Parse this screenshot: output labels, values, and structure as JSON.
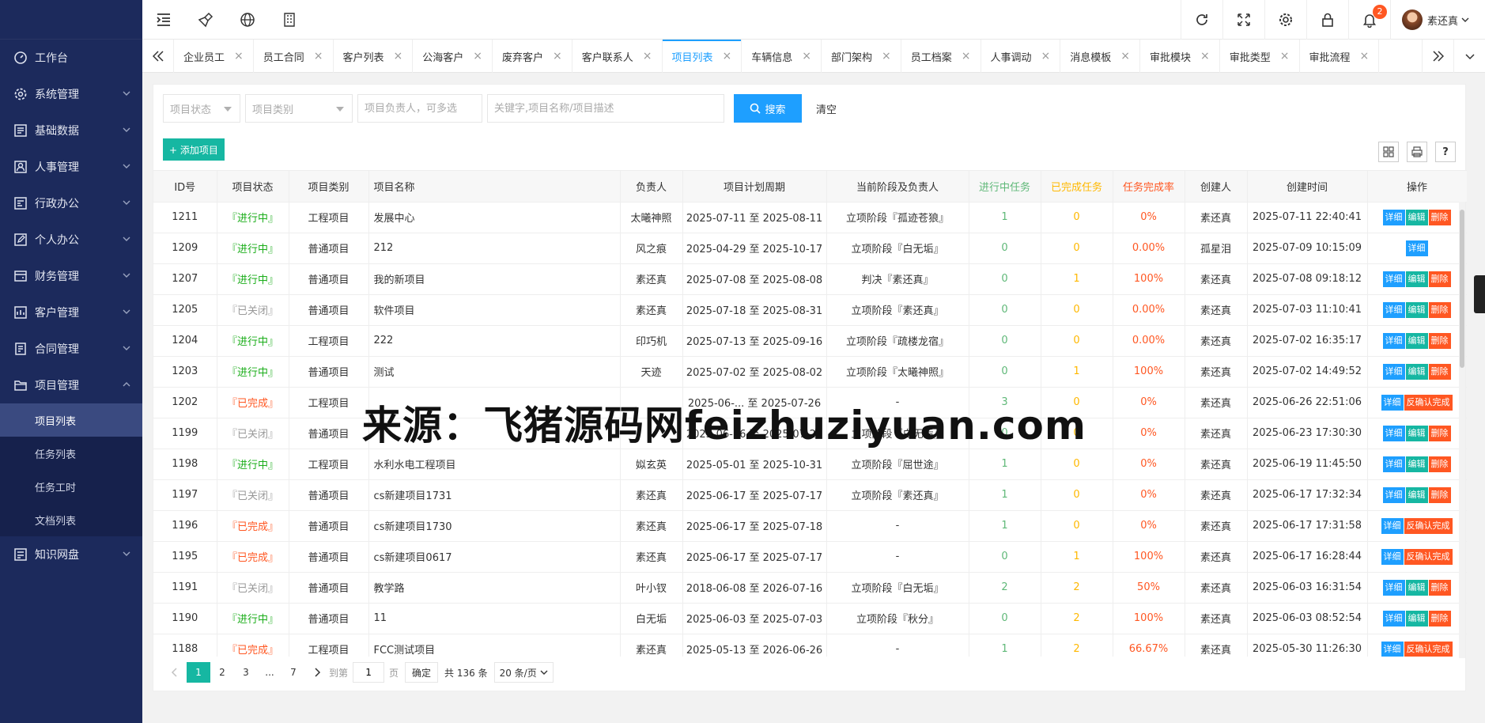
{
  "sidebar": {
    "items": [
      {
        "label": "工作台",
        "icon": "dashboard-icon"
      },
      {
        "label": "系统管理",
        "icon": "gear-icon"
      },
      {
        "label": "基础数据",
        "icon": "data-icon"
      },
      {
        "label": "人事管理",
        "icon": "person-icon"
      },
      {
        "label": "行政办公",
        "icon": "office-icon"
      },
      {
        "label": "个人办公",
        "icon": "edit-icon"
      },
      {
        "label": "财务管理",
        "icon": "finance-icon"
      },
      {
        "label": "客户管理",
        "icon": "customer-icon"
      },
      {
        "label": "合同管理",
        "icon": "contract-icon"
      },
      {
        "label": "项目管理",
        "icon": "folder-icon"
      },
      {
        "label": "知识网盘",
        "icon": "disk-icon"
      }
    ],
    "project_sub": [
      "项目列表",
      "任务列表",
      "任务工时",
      "文档列表"
    ]
  },
  "topbar": {
    "notification_count": "2",
    "user_name": "素还真"
  },
  "tabs": [
    "企业员工",
    "员工合同",
    "客户列表",
    "公海客户",
    "废弃客户",
    "客户联系人",
    "项目列表",
    "车辆信息",
    "部门架构",
    "员工档案",
    "人事调动",
    "消息模板",
    "审批模块",
    "审批类型",
    "审批流程"
  ],
  "filters": {
    "status_placeholder": "项目状态",
    "type_placeholder": "项目类别",
    "owner_placeholder": "项目负责人，可多选",
    "keyword_placeholder": "关键字,项目名称/项目描述",
    "search_label": "搜索",
    "clear_label": "清空"
  },
  "toolbar": {
    "add_label": "+ 添加项目"
  },
  "table": {
    "headers": [
      "ID号",
      "项目状态",
      "项目类别",
      "项目名称",
      "负责人",
      "项目计划周期",
      "当前阶段及负责人",
      "进行中任务",
      "已完成任务",
      "任务完成率",
      "创建人",
      "创建时间",
      "操作"
    ],
    "rows": [
      {
        "id": "1211",
        "status": "『进行中』",
        "st": "running",
        "type": "工程项目",
        "name": "发展中心",
        "owner": "太曦神照",
        "period": "2025-07-11 至 2025-08-11",
        "stage": "立项阶段『孤迹苍狼』",
        "doing": "1",
        "done": "0",
        "rate": "0%",
        "creator": "素还真",
        "created": "2025-07-11 22:40:41",
        "ops": "full"
      },
      {
        "id": "1209",
        "status": "『进行中』",
        "st": "running",
        "type": "普通项目",
        "name": "212",
        "owner": "风之痕",
        "period": "2025-04-29 至 2025-10-17",
        "stage": "立项阶段『白无垢』",
        "doing": "0",
        "done": "0",
        "rate": "0.00%",
        "creator": "孤星泪",
        "created": "2025-07-09 10:15:09",
        "ops": "detail"
      },
      {
        "id": "1207",
        "status": "『进行中』",
        "st": "running",
        "type": "普通项目",
        "name": "我的新项目",
        "owner": "素还真",
        "period": "2025-07-08 至 2025-08-08",
        "stage": "判决『素还真』",
        "doing": "0",
        "done": "1",
        "rate": "100%",
        "creator": "素还真",
        "created": "2025-07-08 09:18:12",
        "ops": "full"
      },
      {
        "id": "1205",
        "status": "『已关闭』",
        "st": "closed",
        "type": "普通项目",
        "name": "软件项目",
        "owner": "素还真",
        "period": "2025-07-18 至 2025-08-31",
        "stage": "立项阶段『素还真』",
        "doing": "0",
        "done": "0",
        "rate": "0.00%",
        "creator": "素还真",
        "created": "2025-07-03 11:10:41",
        "ops": "full"
      },
      {
        "id": "1204",
        "status": "『进行中』",
        "st": "running",
        "type": "工程项目",
        "name": "222",
        "owner": "印巧机",
        "period": "2025-07-13 至 2025-09-16",
        "stage": "立项阶段『疏楼龙宿』",
        "doing": "0",
        "done": "0",
        "rate": "0.00%",
        "creator": "素还真",
        "created": "2025-07-02 16:35:17",
        "ops": "full"
      },
      {
        "id": "1203",
        "status": "『进行中』",
        "st": "running",
        "type": "普通项目",
        "name": "测试",
        "owner": "天迹",
        "period": "2025-07-02 至 2025-08-02",
        "stage": "立项阶段『太曦神照』",
        "doing": "0",
        "done": "1",
        "rate": "100%",
        "creator": "素还真",
        "created": "2025-07-02 14:49:52",
        "ops": "full"
      },
      {
        "id": "1202",
        "status": "『已完成』",
        "st": "done",
        "type": "工程项目",
        "name": "",
        "owner": "",
        "period": "2025-06-... 至 2025-07-26",
        "stage": "-",
        "doing": "3",
        "done": "0",
        "rate": "0%",
        "creator": "素还真",
        "created": "2025-06-26 22:51:06",
        "ops": "reconfirm"
      },
      {
        "id": "1199",
        "status": "『已关闭』",
        "st": "closed",
        "type": "普通项目",
        "name": "",
        "owner": "",
        "period": "2025-06-16 至 2025-07-20",
        "stage": "立项阶段『白无垢』",
        "doing": "0",
        "done": "0",
        "rate": "0%",
        "creator": "素还真",
        "created": "2025-06-23 17:30:30",
        "ops": "full"
      },
      {
        "id": "1198",
        "status": "『进行中』",
        "st": "running",
        "type": "工程项目",
        "name": "水利水电工程项目",
        "owner": "姒玄英",
        "period": "2025-05-01 至 2025-10-31",
        "stage": "立项阶段『屈世途』",
        "doing": "1",
        "done": "0",
        "rate": "0%",
        "creator": "素还真",
        "created": "2025-06-19 11:45:50",
        "ops": "full"
      },
      {
        "id": "1197",
        "status": "『已关闭』",
        "st": "closed",
        "type": "普通项目",
        "name": "cs新建项目1731",
        "owner": "素还真",
        "period": "2025-06-17 至 2025-07-17",
        "stage": "立项阶段『素还真』",
        "doing": "1",
        "done": "0",
        "rate": "0%",
        "creator": "素还真",
        "created": "2025-06-17 17:32:34",
        "ops": "full"
      },
      {
        "id": "1196",
        "status": "『已完成』",
        "st": "done",
        "type": "普通项目",
        "name": "cs新建项目1730",
        "owner": "素还真",
        "period": "2025-06-17 至 2025-07-18",
        "stage": "-",
        "doing": "1",
        "done": "0",
        "rate": "0%",
        "creator": "素还真",
        "created": "2025-06-17 17:31:58",
        "ops": "reconfirm"
      },
      {
        "id": "1195",
        "status": "『已完成』",
        "st": "done",
        "type": "普通项目",
        "name": "cs新建项目0617",
        "owner": "素还真",
        "period": "2025-06-17 至 2025-07-17",
        "stage": "-",
        "doing": "0",
        "done": "1",
        "rate": "100%",
        "creator": "素还真",
        "created": "2025-06-17 16:28:44",
        "ops": "reconfirm"
      },
      {
        "id": "1191",
        "status": "『已关闭』",
        "st": "closed",
        "type": "普通项目",
        "name": "教学路",
        "owner": "叶小钗",
        "period": "2018-06-08 至 2026-07-16",
        "stage": "立项阶段『白无垢』",
        "doing": "2",
        "done": "2",
        "rate": "50%",
        "creator": "素还真",
        "created": "2025-06-03 16:31:54",
        "ops": "full"
      },
      {
        "id": "1190",
        "status": "『进行中』",
        "st": "running",
        "type": "普通项目",
        "name": "11",
        "owner": "白无垢",
        "period": "2025-06-03 至 2025-07-03",
        "stage": "立项阶段『秋分』",
        "doing": "0",
        "done": "2",
        "rate": "100%",
        "creator": "素还真",
        "created": "2025-06-03 08:52:54",
        "ops": "full"
      },
      {
        "id": "1188",
        "status": "『已完成』",
        "st": "done",
        "type": "工程项目",
        "name": "FCC测试项目",
        "owner": "素还真",
        "period": "2025-05-13 至 2026-06-26",
        "stage": "-",
        "doing": "1",
        "done": "2",
        "rate": "66.67%",
        "creator": "素还真",
        "created": "2025-05-30 11:26:30",
        "ops": "reconfirm"
      }
    ],
    "op_labels": {
      "detail": "详细",
      "edit": "编辑",
      "delete": "删除",
      "reconfirm": "反确认完成"
    }
  },
  "pager": {
    "pages": [
      "1",
      "2",
      "3",
      "...",
      "7"
    ],
    "goto_label": "到第",
    "goto_value": "1",
    "page_unit": "页",
    "confirm": "确定",
    "total": "共 136 条",
    "size": "20 条/页"
  },
  "watermark": "来源：飞猪源码网feizhuziyuan.com",
  "colors": {
    "sidebar": "#1c2a5c",
    "accent": "#1e9fff",
    "teal": "#16b7a2",
    "danger": "#ff5722"
  }
}
